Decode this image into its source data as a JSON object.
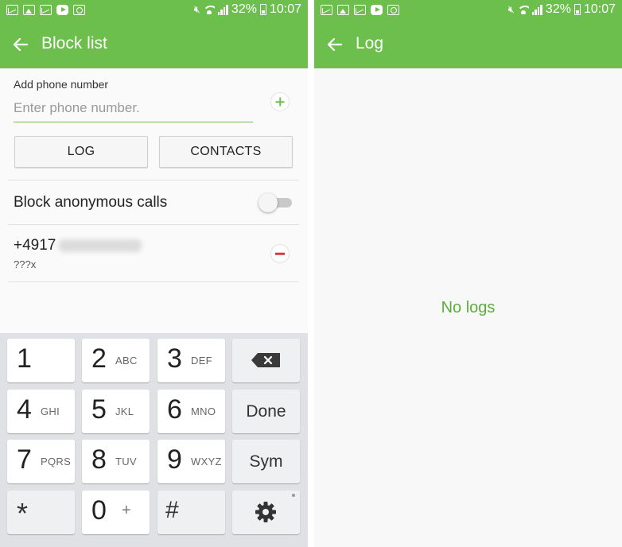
{
  "colors": {
    "accent": "#6cbf4c",
    "accent_text": "#5cae3c",
    "remove": "#d23c3c"
  },
  "status_bar": {
    "notification_icons": [
      "gmail-icon",
      "gallery-icon",
      "gmail-icon",
      "youtube-icon",
      "camera-icon"
    ],
    "battery": "32%",
    "time": "10:07"
  },
  "block_list": {
    "title": "Block list",
    "add_label": "Add phone number",
    "input_placeholder": "Enter phone number.",
    "input_value": "",
    "log_button": "LOG",
    "contacts_button": "CONTACTS",
    "anonymous_label": "Block anonymous calls",
    "anonymous_enabled": false,
    "entries": [
      {
        "number_prefix": "+4917",
        "subtitle": "???x"
      }
    ]
  },
  "keypad": {
    "rows": [
      [
        {
          "digit": "1",
          "letters": ""
        },
        {
          "digit": "2",
          "letters": "ABC"
        },
        {
          "digit": "3",
          "letters": "DEF"
        }
      ],
      [
        {
          "digit": "4",
          "letters": "GHI"
        },
        {
          "digit": "5",
          "letters": "JKL"
        },
        {
          "digit": "6",
          "letters": "MNO"
        }
      ],
      [
        {
          "digit": "7",
          "letters": "PQRS"
        },
        {
          "digit": "8",
          "letters": "TUV"
        },
        {
          "digit": "9",
          "letters": "WXYZ"
        }
      ]
    ],
    "star": "*",
    "zero": "0",
    "zero_alt": "+",
    "hash": "#",
    "done": "Done",
    "sym": "Sym"
  },
  "log": {
    "title": "Log",
    "empty_message": "No logs"
  }
}
